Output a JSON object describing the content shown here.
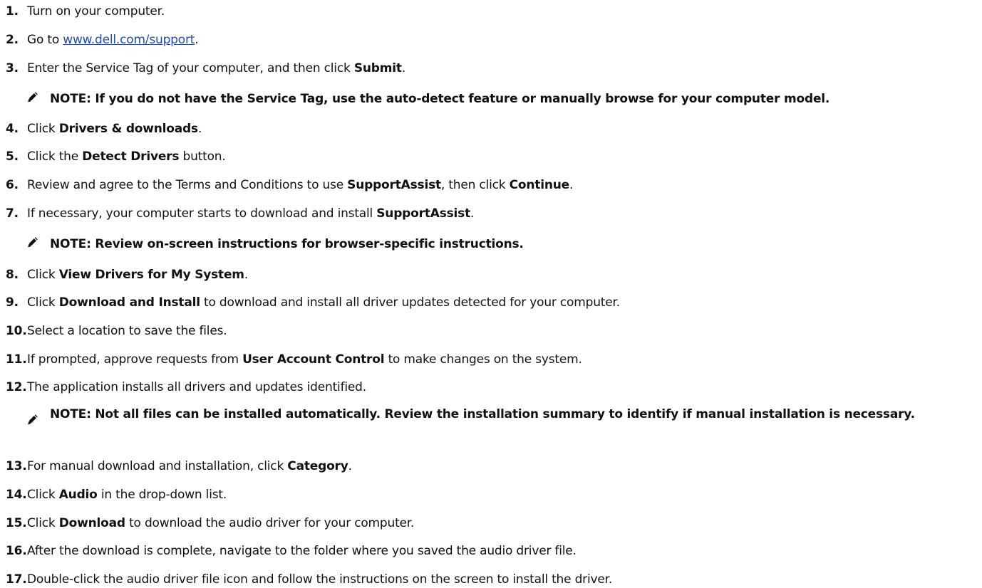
{
  "steps": [
    {
      "num": "1.",
      "parts": [
        {
          "t": "Turn on your computer."
        }
      ]
    },
    {
      "num": "2.",
      "parts": [
        {
          "t": "Go to "
        },
        {
          "t": "www.dell.com/support",
          "link": true
        },
        {
          "t": "."
        }
      ]
    },
    {
      "num": "3.",
      "parts": [
        {
          "t": "Enter the Service Tag of your computer, and then click "
        },
        {
          "t": "Submit",
          "b": true
        },
        {
          "t": "."
        }
      ]
    },
    {
      "num": "4.",
      "parts": [
        {
          "t": "Click "
        },
        {
          "t": "Drivers & downloads",
          "b": true
        },
        {
          "t": "."
        }
      ]
    },
    {
      "num": "5.",
      "parts": [
        {
          "t": "Click the "
        },
        {
          "t": "Detect Drivers",
          "b": true
        },
        {
          "t": " button."
        }
      ]
    },
    {
      "num": "6.",
      "parts": [
        {
          "t": "Review and agree to the Terms and Conditions to use "
        },
        {
          "t": "SupportAssist",
          "b": true
        },
        {
          "t": ", then click "
        },
        {
          "t": "Continue",
          "b": true
        },
        {
          "t": "."
        }
      ]
    },
    {
      "num": "7.",
      "parts": [
        {
          "t": "If necessary, your computer starts to download and install "
        },
        {
          "t": "SupportAssist",
          "b": true
        },
        {
          "t": "."
        }
      ]
    },
    {
      "num": "8.",
      "parts": [
        {
          "t": "Click "
        },
        {
          "t": "View Drivers for My System",
          "b": true
        },
        {
          "t": "."
        }
      ]
    },
    {
      "num": "9.",
      "parts": [
        {
          "t": "Click "
        },
        {
          "t": "Download and Install",
          "b": true
        },
        {
          "t": " to download and install all driver updates detected for your computer."
        }
      ]
    },
    {
      "num": "10.",
      "parts": [
        {
          "t": "Select a location to save the files."
        }
      ]
    },
    {
      "num": "11.",
      "parts": [
        {
          "t": "If prompted, approve requests from "
        },
        {
          "t": "User Account Control",
          "b": true
        },
        {
          "t": " to make changes on the system."
        }
      ]
    },
    {
      "num": "12.",
      "parts": [
        {
          "t": "The application installs all drivers and updates identified."
        }
      ]
    },
    {
      "num": "13.",
      "parts": [
        {
          "t": "For manual download and installation, click "
        },
        {
          "t": "Category",
          "b": true
        },
        {
          "t": "."
        }
      ]
    },
    {
      "num": "14.",
      "parts": [
        {
          "t": "Click "
        },
        {
          "t": "Audio",
          "b": true
        },
        {
          "t": " in the drop-down list."
        }
      ]
    },
    {
      "num": "15.",
      "parts": [
        {
          "t": "Click "
        },
        {
          "t": "Download",
          "b": true
        },
        {
          "t": " to download the audio driver for your computer."
        }
      ]
    },
    {
      "num": "16.",
      "parts": [
        {
          "t": "After the download is complete, navigate to the folder where you saved the audio driver file."
        }
      ]
    },
    {
      "num": "17.",
      "parts": [
        {
          "t": "Double-click the audio driver file icon and follow the instructions on the screen to install the driver."
        }
      ]
    }
  ],
  "notes": [
    {
      "text": "NOTE: If you do not have the Service Tag, use the auto-detect feature or manually browse for your computer model.",
      "icon": "pencil-note-icon"
    },
    {
      "text": "NOTE: Review on-screen instructions for browser-specific instructions.",
      "icon": "pencil-note-icon"
    },
    {
      "text": "NOTE: Not all files can be installed automatically. Review the installation summary to identify if manual installation is necessary.",
      "icon": "pencil-note-icon"
    }
  ],
  "colors": {
    "text": "#111111",
    "link": "#1b4fb4"
  }
}
